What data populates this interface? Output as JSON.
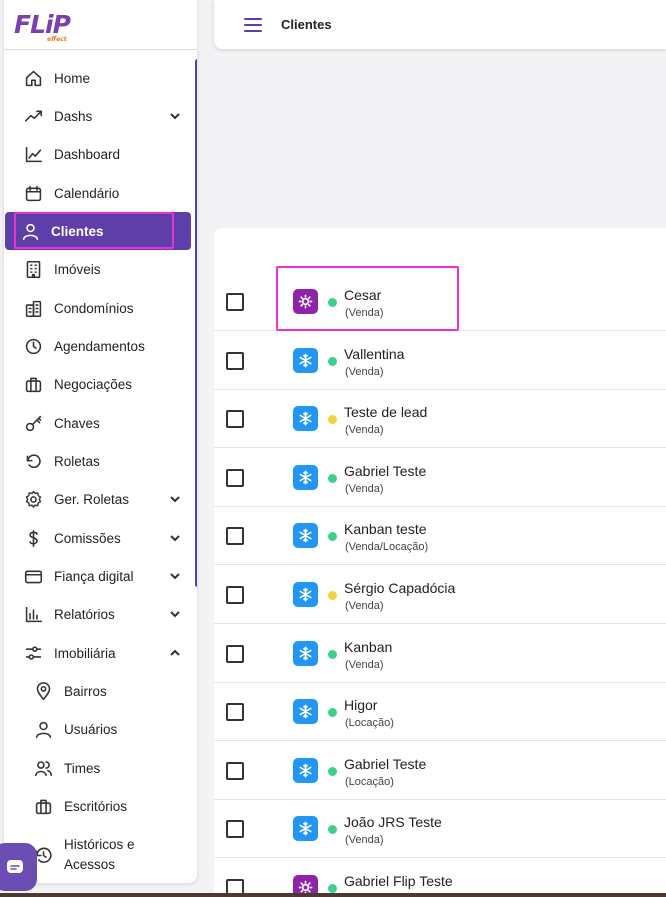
{
  "brand": {
    "logo_main": "FLiP",
    "logo_sub": "effect"
  },
  "header": {
    "title": "Clientes"
  },
  "sidebar": {
    "items": [
      {
        "label": "Home",
        "icon": "home-icon"
      },
      {
        "label": "Dashs",
        "icon": "trending-up-icon",
        "expandable": true
      },
      {
        "label": "Dashboard",
        "icon": "line-chart-icon"
      },
      {
        "label": "Calendário",
        "icon": "calendar-icon"
      },
      {
        "label": "Clientes",
        "icon": "user-icon",
        "active": true
      },
      {
        "label": "Imóveis",
        "icon": "building-icon"
      },
      {
        "label": "Condomínios",
        "icon": "buildings-icon"
      },
      {
        "label": "Agendamentos",
        "icon": "clock-icon"
      },
      {
        "label": "Negociações",
        "icon": "briefcase-icon"
      },
      {
        "label": "Chaves",
        "icon": "key-icon"
      },
      {
        "label": "Roletas",
        "icon": "rotate-icon"
      },
      {
        "label": "Ger. Roletas",
        "icon": "gear-icon",
        "expandable": true
      },
      {
        "label": "Comissões",
        "icon": "dollar-icon",
        "expandable": true
      },
      {
        "label": "Fiança digital",
        "icon": "credit-card-icon",
        "expandable": true
      },
      {
        "label": "Relatórios",
        "icon": "bar-chart-icon",
        "expandable": true
      },
      {
        "label": "Imobiliária",
        "icon": "sliders-icon",
        "expandable": true,
        "expanded": true
      }
    ],
    "subitems": [
      {
        "label": "Bairros",
        "icon": "map-pin-icon"
      },
      {
        "label": "Usuários",
        "icon": "user-icon"
      },
      {
        "label": "Times",
        "icon": "users-icon"
      },
      {
        "label": "Escritórios",
        "icon": "briefcase-icon"
      },
      {
        "label": "Históricos e Acessos",
        "line1": "Históricos e",
        "line2": "Acessos",
        "icon": "history-icon"
      }
    ]
  },
  "clients": [
    {
      "name": "Cesar",
      "type": "(Venda)",
      "temperature": "hot",
      "status": "green"
    },
    {
      "name": "Vallentina",
      "type": "(Venda)",
      "temperature": "cold",
      "status": "green"
    },
    {
      "name": "Teste de lead",
      "type": "(Venda)",
      "temperature": "cold",
      "status": "yellow"
    },
    {
      "name": "Gabriel Teste",
      "type": "(Venda)",
      "temperature": "cold",
      "status": "green"
    },
    {
      "name": "Kanban teste",
      "type": "(Venda/Locação)",
      "temperature": "cold",
      "status": "green"
    },
    {
      "name": "Sérgio Capadócia",
      "type": "(Venda)",
      "temperature": "cold",
      "status": "yellow"
    },
    {
      "name": "Kanban",
      "type": "(Venda)",
      "temperature": "cold",
      "status": "green"
    },
    {
      "name": "Higor",
      "type": "(Locação)",
      "temperature": "cold",
      "status": "green"
    },
    {
      "name": "Gabriel Teste",
      "type": "(Locação)",
      "temperature": "cold",
      "status": "green"
    },
    {
      "name": "João JRS Teste",
      "type": "(Venda)",
      "temperature": "cold",
      "status": "green"
    },
    {
      "name": "Gabriel Flip Teste",
      "type": "",
      "temperature": "hot",
      "status": "green"
    }
  ],
  "colors": {
    "accent": "#5e3ea8",
    "highlight": "#ee2fd6",
    "hot_badge": "#8e24aa",
    "cold_badge": "#2196f3",
    "status_green": "#3ccf8e",
    "status_yellow": "#f5d142"
  }
}
